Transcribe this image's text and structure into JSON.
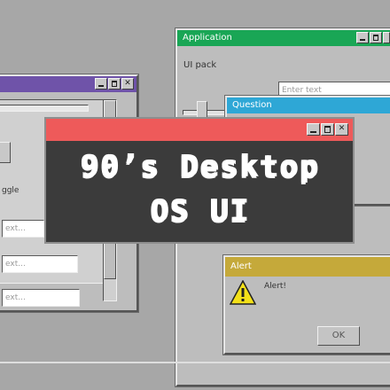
{
  "desktop": {
    "background": "#a7a7a7"
  },
  "purple_window": {
    "title_color": "#6f53a9",
    "toggle_label": "ggle",
    "fields": [
      "ext...",
      "ext...",
      "ext..."
    ]
  },
  "application_window": {
    "title": "Application",
    "title_color": "#19a655",
    "subtitle": "UI pack",
    "input_placeholder": "Enter text"
  },
  "question_window": {
    "title": "Question",
    "title_color": "#2ea7d6"
  },
  "alert_window": {
    "title": "Alert",
    "title_color": "#c5a93a",
    "message": "Alert!",
    "ok_label": "OK",
    "icon": "warning-icon"
  },
  "banner": {
    "title_color": "#ee5a5a",
    "line1": "90’s Desktop",
    "line2": "OS UI"
  },
  "title_buttons": {
    "minimize": "minimize-icon",
    "maximize": "maximize-icon",
    "close": "close-icon",
    "close_glyph": "✕"
  }
}
